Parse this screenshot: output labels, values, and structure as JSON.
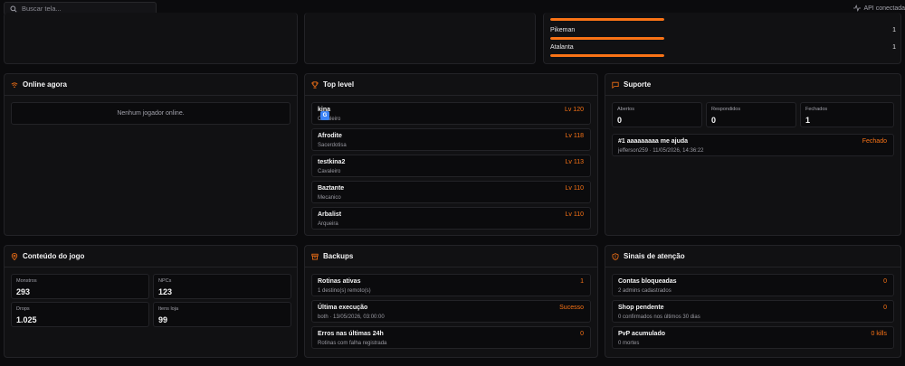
{
  "search": {
    "placeholder": "Buscar tela..."
  },
  "api_status": {
    "label": "API conectada"
  },
  "class_dist": {
    "rows": [
      {
        "name": "Pikeman",
        "count": "1",
        "fill": 1.0
      },
      {
        "name": "Atalanta",
        "count": "1",
        "fill": 1.0
      }
    ]
  },
  "online": {
    "title": "Online agora",
    "empty": "Nenhum jogador online."
  },
  "top_level": {
    "title": "Top level",
    "players": [
      {
        "name": "kina",
        "class": "Cavaleiro",
        "level": "Lv 120"
      },
      {
        "name": "Afrodite",
        "class": "Sacerdotisa",
        "level": "Lv 118"
      },
      {
        "name": "testkina2",
        "class": "Cavaleiro",
        "level": "Lv 113"
      },
      {
        "name": "Baztante",
        "class": "Mecanico",
        "level": "Lv 110"
      },
      {
        "name": "Arbalist",
        "class": "Arqueira",
        "level": "Lv 110"
      }
    ]
  },
  "suporte": {
    "title": "Suporte",
    "stats": [
      {
        "label": "Abertos",
        "value": "0"
      },
      {
        "label": "Respondidos",
        "value": "0"
      },
      {
        "label": "Fechados",
        "value": "1"
      }
    ],
    "ticket": {
      "title": "#1 aaaaaaaaa me ajuda",
      "meta": "jefferson259 · 11/05/2026, 14:36:22",
      "status": "Fechado"
    }
  },
  "conteudo": {
    "title": "Conteúdo do jogo",
    "stats": [
      {
        "label": "Monstros",
        "value": "293"
      },
      {
        "label": "NPCs",
        "value": "123"
      },
      {
        "label": "Drops",
        "value": "1.025"
      },
      {
        "label": "Itens loja",
        "value": "99"
      }
    ]
  },
  "backups": {
    "title": "Backups",
    "rows": [
      {
        "title": "Rotinas ativas",
        "sub": "1 destino(s) remoto(s)",
        "value": "1"
      },
      {
        "title": "Última execução",
        "sub": "both · 13/05/2026, 03:00:00",
        "value": "Sucesso"
      },
      {
        "title": "Erros nas últimas 24h",
        "sub": "Rotinas com falha registrada",
        "value": "0"
      }
    ]
  },
  "sinais": {
    "title": "Sinais de atenção",
    "rows": [
      {
        "title": "Contas bloqueadas",
        "sub": "2 admins cadastrados",
        "value": "0"
      },
      {
        "title": "Shop pendente",
        "sub": "0 confirmados nos últimos 30 dias",
        "value": "0"
      },
      {
        "title": "PvP acumulado",
        "sub": "0 mortes",
        "value": "0 kills"
      }
    ]
  },
  "colors": {
    "accent": "#f97316",
    "background": "#0b0b0d",
    "card": "#111113"
  }
}
